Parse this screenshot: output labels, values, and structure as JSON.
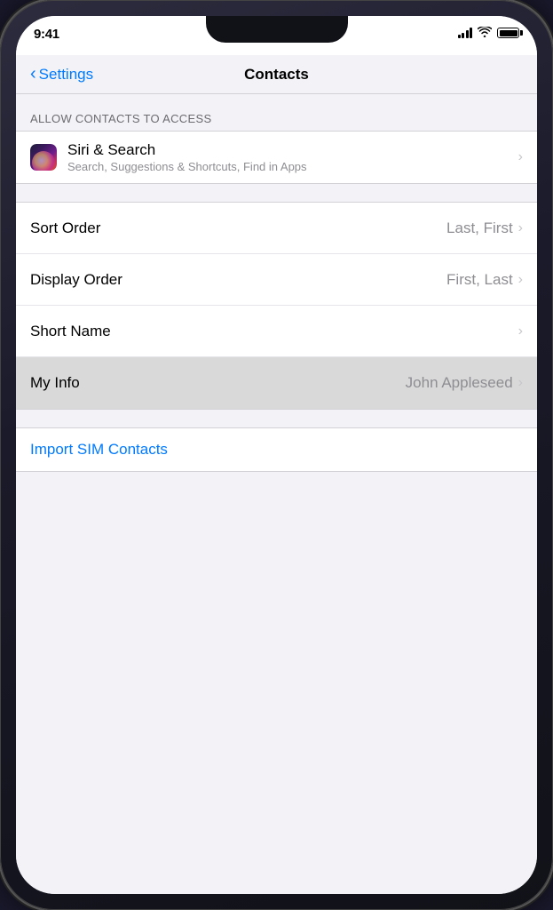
{
  "statusBar": {
    "time": "9:41",
    "signal": "signal-icon",
    "wifi": "wifi-icon",
    "battery": "battery-icon"
  },
  "navBar": {
    "backLabel": "Settings",
    "title": "Contacts"
  },
  "sectionLabel": "ALLOW CONTACTS TO ACCESS",
  "siriRow": {
    "title": "Siri & Search",
    "subtitle": "Search, Suggestions & Shortcuts, Find in Apps"
  },
  "settingsRows": [
    {
      "id": "sort-order",
      "title": "Sort Order",
      "value": "Last, First"
    },
    {
      "id": "display-order",
      "title": "Display Order",
      "value": "First, Last"
    },
    {
      "id": "short-name",
      "title": "Short Name",
      "value": ""
    },
    {
      "id": "my-info",
      "title": "My Info",
      "value": "John Appleseed",
      "highlighted": true
    }
  ],
  "importLabel": "Import SIM Contacts",
  "chevron": "›"
}
